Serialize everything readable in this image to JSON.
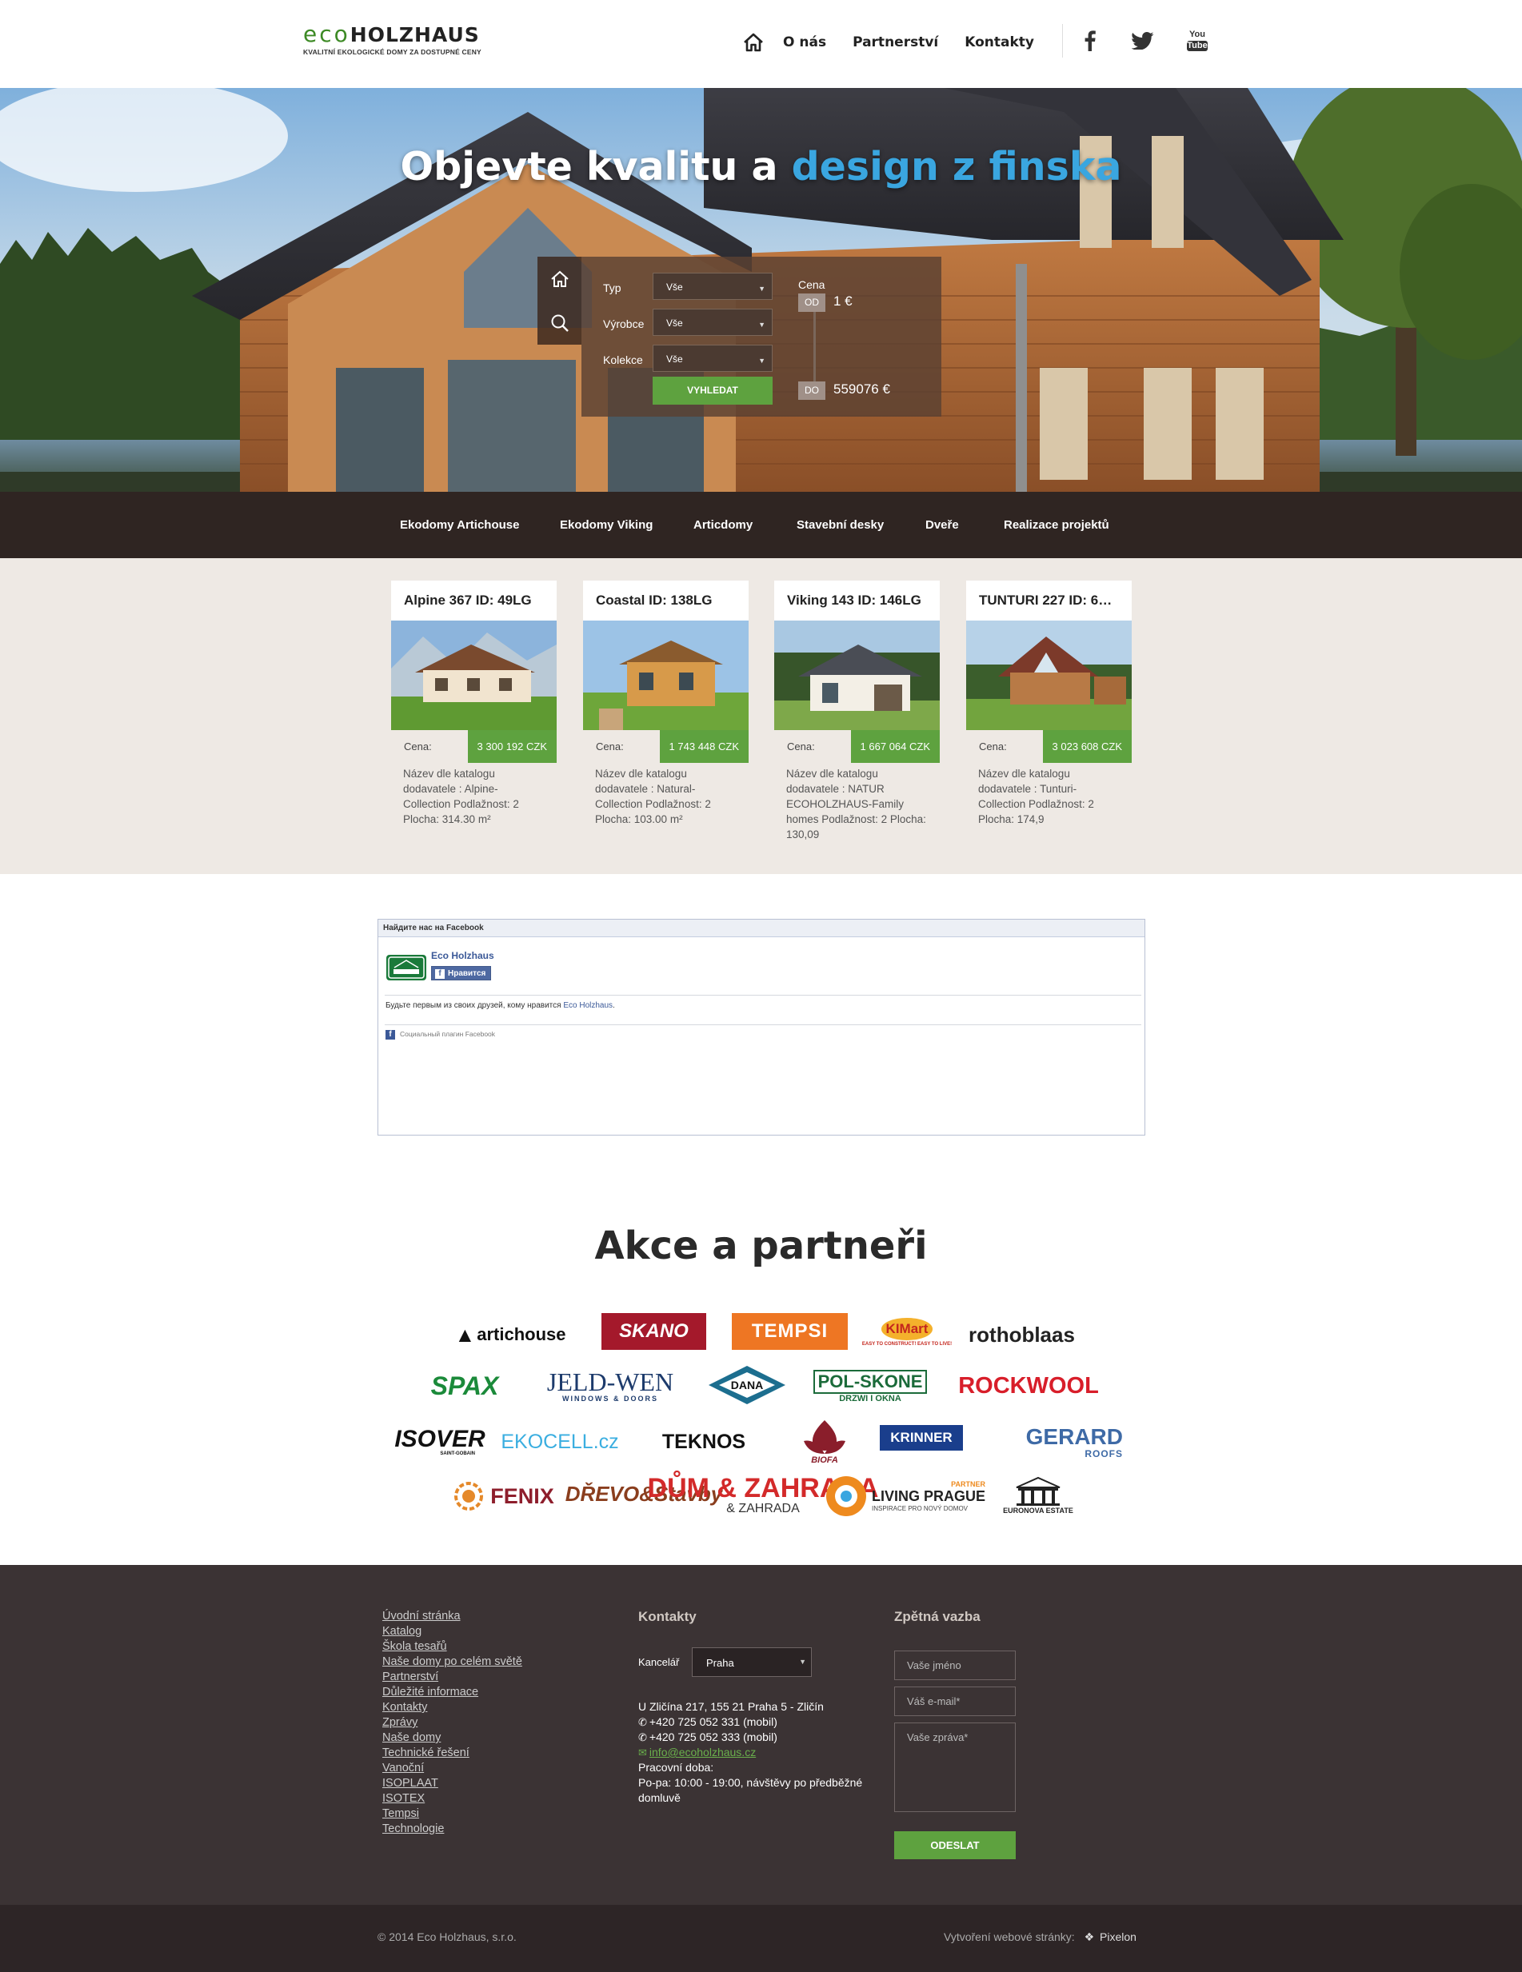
{
  "header": {
    "logo_eco": "eco",
    "logo_holzhaus": "HOLZHAUS",
    "logo_tagline": "KVALITNÍ EKOLOGICKÉ DOMY ZA DOSTUPNÉ CENY",
    "nav": [
      "O nás",
      "Partnerství",
      "Kontakty"
    ],
    "social": [
      "facebook-icon",
      "twitter-icon",
      "youtube-icon"
    ],
    "youtube_top": "You",
    "youtube_bottom": "Tube"
  },
  "hero": {
    "title_plain": "Objevte kvalitu a ",
    "title_highlight": "design z finska",
    "highlight_color": "#3aa6e0",
    "search": {
      "labels": [
        "Typ",
        "Výrobce",
        "Kolekce"
      ],
      "values": [
        "Vše",
        "Vše",
        "Vše"
      ],
      "button": "VYHLEDAT",
      "price_label": "Cena",
      "from_badge": "OD",
      "from_value": "1 €",
      "to_badge": "DO",
      "to_value": "559076 €"
    }
  },
  "categories": [
    "Ekodomy Artichouse",
    "Ekodomy Viking",
    "Articdomy",
    "Stavební desky",
    "Dveře",
    "Realizace projektů"
  ],
  "products": [
    {
      "title": "Alpine 367 ID: 49LG",
      "price_label": "Cena:",
      "price": "3 300 192 CZK",
      "desc": "Název dle katalogu dodavatele : Alpine-Collection Podlažnost: 2 Plocha: 314.30 m²"
    },
    {
      "title": "Coastal ID: 138LG",
      "price_label": "Cena:",
      "price": "1 743 448 CZK",
      "desc": "Název dle katalogu dodavatele : Natural-Collection Podlažnost: 2 Plocha: 103.00 m²"
    },
    {
      "title": "Viking 143 ID: 146LG",
      "price_label": "Cena:",
      "price": "1 667 064 CZK",
      "desc": "Název dle katalogu dodavatele : NATUR ECOHOLZHAUS-Family homes Podlažnost: 2 Plocha: 130,09"
    },
    {
      "title": "TUNTURI 227 ID: 6…",
      "price_label": "Cena:",
      "price": "3 023 608 CZK",
      "desc": "Název dle katalogu dodavatele : Tunturi-Collection Podlažnost: 2 Plocha: 174,9"
    }
  ],
  "facebook": {
    "header": "Найдите нас на Facebook",
    "page_name": "Eco Holzhaus",
    "like_button": "Нравится",
    "text_before": "Будьте первым из своих друзей, кому нравится ",
    "text_link": "Eco Holzhaus",
    "text_after": ".",
    "plugin_note": "Социальный плагин Facebook"
  },
  "partners": {
    "title": "Akce a partneři",
    "logos": [
      "artichouse",
      "SKANO",
      "TEMPSI",
      "KIMart",
      "rothoblaas",
      "SPAX",
      "JELD-WEN",
      "DANA",
      "POL-SKONE",
      "ROCKWOOL",
      "ISOVER",
      "EKOCELL.cz",
      "TEKNOS",
      "BIOFA",
      "KRINNER",
      "GERARD",
      "FENIX",
      "DŘEVO&Stavby",
      "DŮM & ZAHRADA",
      "LIVING PRAGUE",
      "EURONOVA ESTATE"
    ],
    "logo_sub": {
      "kimart": "EASY TO CONSTRUCT! EASY TO LIVE!",
      "jeldwen": "WINDOWS & DOORS",
      "polskone": "DRZWI I OKNA",
      "isover": "SAINT-GOBAIN",
      "gerard": "ROOFS",
      "dum": "& ZAHRADA",
      "living_partner": "PARTNER",
      "living": "INSPIRACE PRO NOVÝ DOMOV",
      "euronova": "ESTATE"
    }
  },
  "footer": {
    "links": [
      "Úvodní stránka",
      "Katalog",
      "Škola tesařů",
      "Naše domy po celém světě",
      "Partnerství",
      "Důležité informace",
      "Kontakty",
      "Zprávy",
      "Naše domy",
      "Technické řešení",
      "Vanoční",
      "ISOPLAAT",
      "ISOTEX",
      "Tempsi",
      "Technologie"
    ],
    "contacts_title": "Kontakty",
    "office_label": "Kancelář",
    "office_value": "Praha",
    "address": "U Zličína 217, 155 21 Praha 5 - Zličín",
    "phone1": "+420 725 052 331 (mobil)",
    "phone2": "+420 725 052 333 (mobil)",
    "email": "info@ecoholzhaus.cz",
    "hours_title": "Pracovní doba:",
    "hours": "Po-pa: 10:00 - 19:00, návštěvy po předběžné domluvě",
    "feedback_title": "Zpětná vazba",
    "name_placeholder": "Vaše jméno",
    "email_placeholder": "Váš e-mail*",
    "message_placeholder": "Vaše zpráva*",
    "send_button": "ODESLAT",
    "copyright": "© 2014 Eco Holzhaus, s.r.o.",
    "credit_label": "Vytvoření webové stránky:",
    "credit_name": "Pixelon"
  }
}
